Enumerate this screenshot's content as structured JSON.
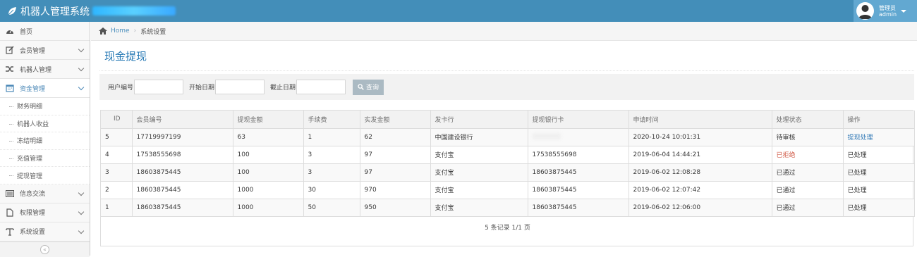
{
  "app": {
    "title": "机器人管理系统"
  },
  "user": {
    "role": "管理员",
    "name": "admin"
  },
  "sidebar": {
    "items": [
      {
        "label": "首页",
        "icon": "dashboard-icon"
      },
      {
        "label": "会员管理",
        "icon": "edit-icon"
      },
      {
        "label": "机器人管理",
        "icon": "shuffle-icon"
      },
      {
        "label": "资金管理",
        "icon": "calendar-icon"
      },
      {
        "label": "信息交流",
        "icon": "list-icon"
      },
      {
        "label": "权限管理",
        "icon": "file-icon"
      },
      {
        "label": "系统设置",
        "icon": "text-icon"
      }
    ],
    "submenu": [
      "财务明细",
      "机器人收益",
      "冻结明细",
      "充值管理",
      "提现管理"
    ]
  },
  "breadcrumb": {
    "home": "Home",
    "current": "系统设置"
  },
  "page": {
    "title": "现金提现"
  },
  "filter": {
    "member_label": "用户编号",
    "start_label": "开始日期",
    "end_label": "截止日期",
    "search_button": "查询"
  },
  "table": {
    "headers": [
      "ID",
      "会员编号",
      "提现金额",
      "手续费",
      "实发金额",
      "发卡行",
      "提现银行卡",
      "申请时间",
      "处理状态",
      "操作"
    ],
    "rows": [
      {
        "id": "5",
        "member": "17719997199",
        "amount": "63",
        "fee": "1",
        "actual": "62",
        "bank": "中国建设银行",
        "card": "",
        "time": "2020-10-24 10:01:31",
        "status": "待审核",
        "action": "提现处理"
      },
      {
        "id": "4",
        "member": "17538555698",
        "amount": "100",
        "fee": "3",
        "actual": "97",
        "bank": "支付宝",
        "card": "17538555698",
        "time": "2019-06-04 14:44:21",
        "status": "已拒绝",
        "action": "已处理"
      },
      {
        "id": "3",
        "member": "18603875445",
        "amount": "100",
        "fee": "3",
        "actual": "97",
        "bank": "支付宝",
        "card": "18603875445",
        "time": "2019-06-02 12:08:28",
        "status": "已通过",
        "action": "已处理"
      },
      {
        "id": "2",
        "member": "18603875445",
        "amount": "1000",
        "fee": "30",
        "actual": "970",
        "bank": "支付宝",
        "card": "18603875445",
        "time": "2019-06-02 12:07:42",
        "status": "已通过",
        "action": "已处理"
      },
      {
        "id": "1",
        "member": "18603875445",
        "amount": "1000",
        "fee": "50",
        "actual": "950",
        "bank": "支付宝",
        "card": "18603875445",
        "time": "2019-06-02 12:06:00",
        "status": "已通过",
        "action": "已处理"
      }
    ],
    "footer": "5 条记录 1/1 页"
  },
  "colors": {
    "topbar": "#438eb9",
    "link": "#337ab7",
    "rejected": "#d15b47"
  }
}
